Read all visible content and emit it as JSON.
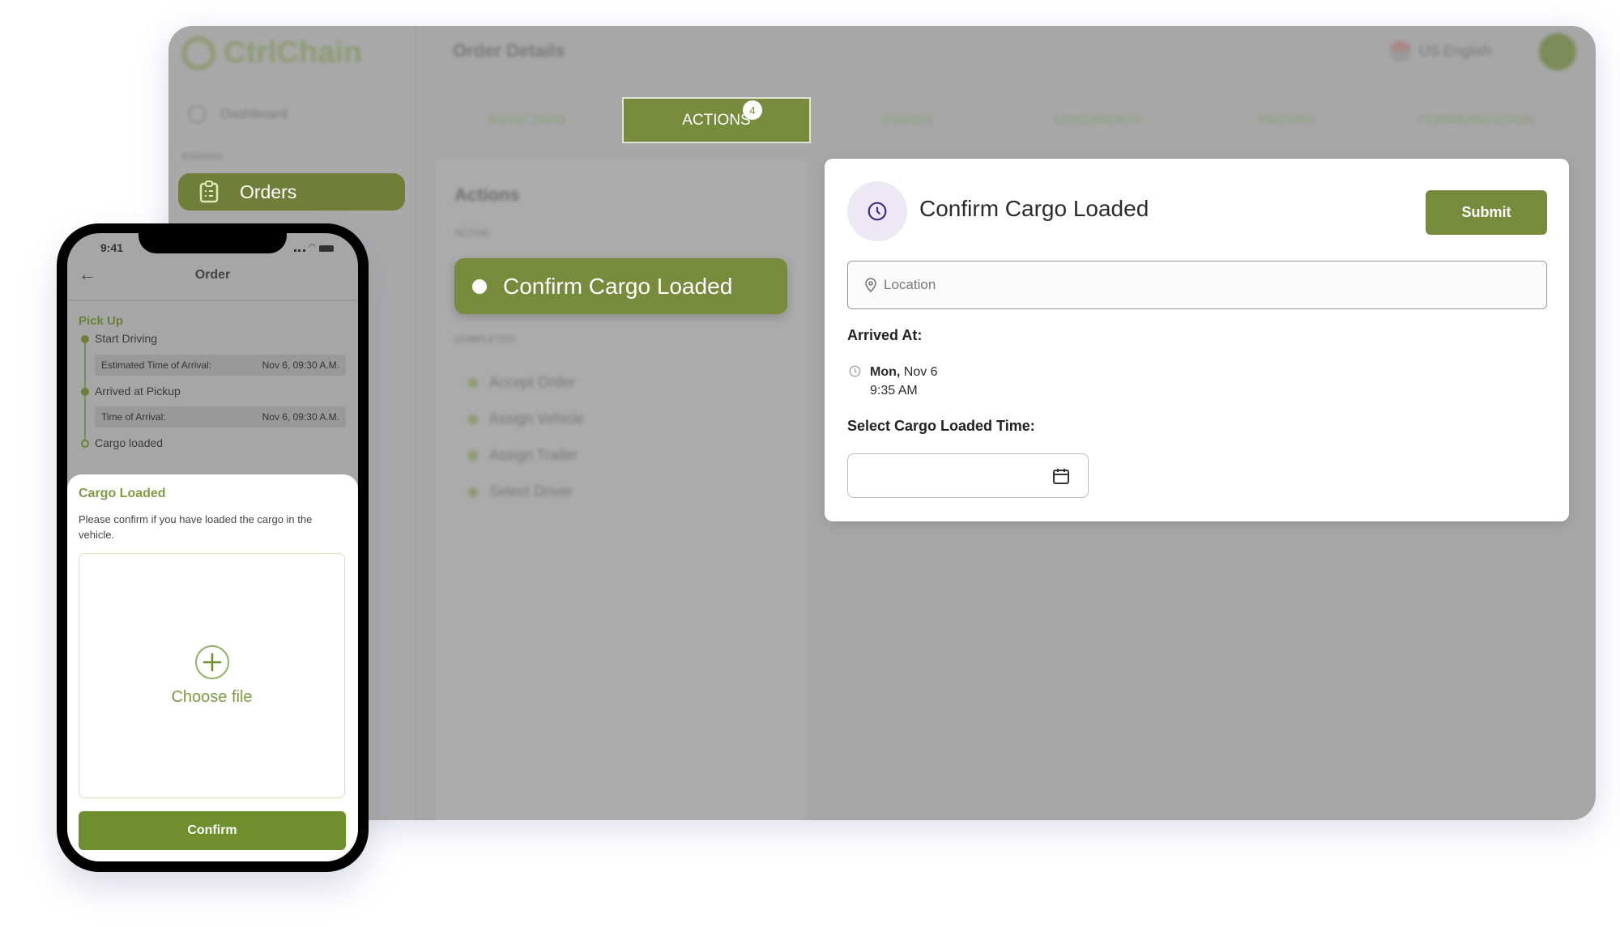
{
  "app": {
    "logo": "CtrlChain",
    "header_title": "Order Details",
    "language": "US English"
  },
  "sidebar": {
    "dashboard": "Dashboard",
    "section": "BOOKING",
    "orders": "Orders"
  },
  "tabs": [
    {
      "label": "BASIC INFO"
    },
    {
      "label": "ACTIONS",
      "badge": "4"
    },
    {
      "label": "CARGO"
    },
    {
      "label": "DOCUMENTS"
    },
    {
      "label": "PRICING"
    },
    {
      "label": "COMMUNICATION"
    }
  ],
  "actions": {
    "title": "Actions",
    "active_label": "ACTIVE",
    "active_item": "Confirm Cargo Loaded",
    "completed_label": "COMPLETED",
    "completed": [
      "Accept Order",
      "Assign Vehicle",
      "Assign Trailer",
      "Select Driver"
    ]
  },
  "card": {
    "title": "Confirm Cargo Loaded",
    "submit": "Submit",
    "location_placeholder": "Location",
    "arrived_label": "Arrived At:",
    "arrived_day": "Mon,",
    "arrived_date": " Nov 6",
    "arrived_time": "9:35 AM",
    "select_label": "Select Cargo Loaded Time:",
    "select_value": ""
  },
  "phone": {
    "time": "9:41",
    "title": "Order",
    "section": "Pick Up",
    "steps": [
      {
        "label": "Start Driving",
        "field": "Estimated Time of Arrival:",
        "value": "Nov 6, 09:30 A.M."
      },
      {
        "label": "Arrived at Pickup",
        "field": "Time of Arrival:",
        "value": "Nov 6, 09:30 A.M."
      },
      {
        "label": "Cargo loaded"
      }
    ],
    "sheet": {
      "title": "Cargo Loaded",
      "description": "Please confirm if you have loaded the cargo in the vehicle.",
      "choose_file": "Choose file",
      "confirm": "Confirm"
    }
  },
  "colors": {
    "brand": "#788b3d",
    "accent_light": "#ece9f5",
    "clock_icon": "#3b2e80"
  }
}
